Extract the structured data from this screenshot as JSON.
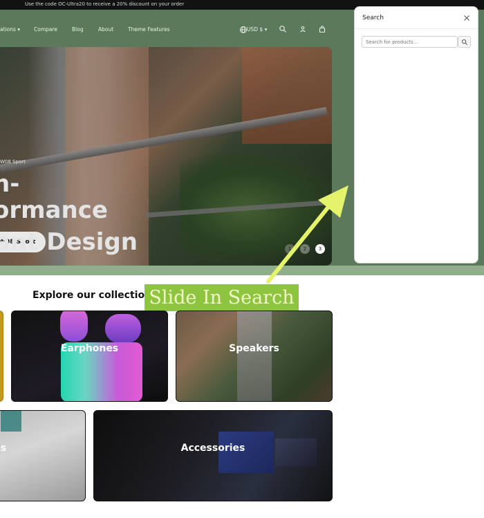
{
  "announcement": {
    "text": "Use the code OC-Ultra20 to receive a 20% discount on your order"
  },
  "nav": {
    "items": [
      {
        "label": "ations ▾"
      },
      {
        "label": "Compare"
      },
      {
        "label": "Blog"
      },
      {
        "label": "About"
      },
      {
        "label": "Theme Features"
      },
      {
        "label": "USD $ ▾"
      }
    ],
    "icons": [
      "globe-icon",
      "search-icon",
      "account-icon",
      "cart-icon"
    ]
  },
  "hero": {
    "subtitle": "W08 Sport",
    "headline_lines": [
      "n-",
      "ormance",
      "ant Design"
    ],
    "cta_label": "W08 Sport",
    "slides": [
      "1",
      "2",
      "3"
    ],
    "active_slide": 3
  },
  "search_panel": {
    "title": "Search",
    "placeholder": "Search for products..."
  },
  "annotation": {
    "label": "Slide In Search",
    "color": "#8dc440",
    "arrow_color": "#e4f36b"
  },
  "collections": {
    "title": "Explore our collections",
    "cards": [
      {
        "label": "Earphones"
      },
      {
        "label": "Speakers"
      },
      {
        "label": "s"
      },
      {
        "label": "Accessories"
      }
    ]
  },
  "colors": {
    "header_green": "#5b7a5b",
    "announcement_bg": "#121212"
  }
}
